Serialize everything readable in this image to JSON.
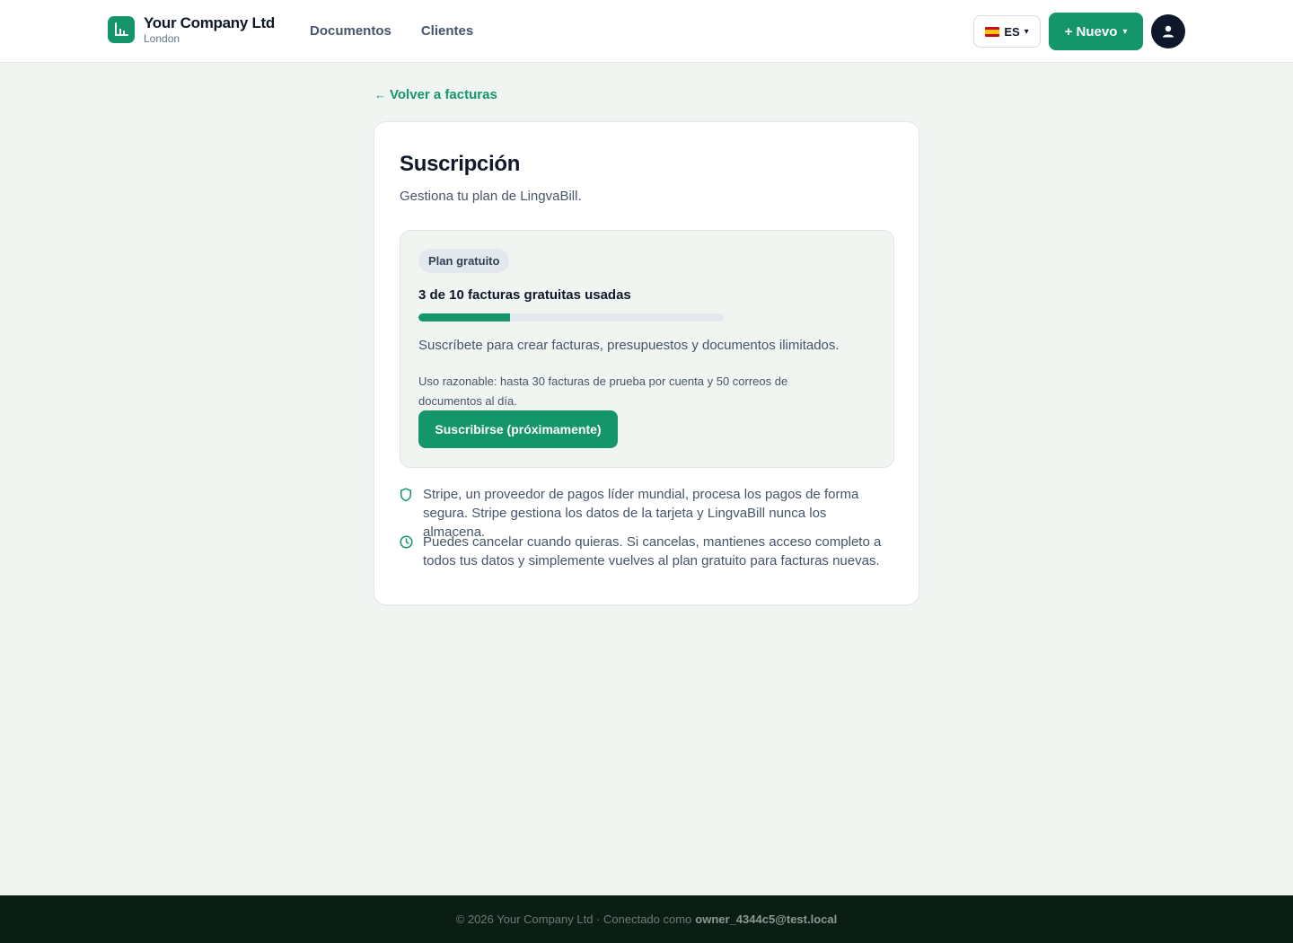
{
  "header": {
    "company_name": "Your Company Ltd",
    "company_city": "London",
    "nav": [
      "Documentos",
      "Clientes"
    ],
    "language": "ES",
    "new_button": "+ Nuevo",
    "brand_color": "#15966a"
  },
  "back_link": "Volver a facturas",
  "card": {
    "title": "Suscripción",
    "subtitle": "Gestiona tu plan de LingvaBill.",
    "plan": {
      "badge": "Plan gratuito",
      "usage_title": "3 de 10 facturas gratuitas usadas",
      "usage_fraction": 0.3,
      "description": "Suscríbete para crear facturas, presupuestos y documentos ilimitados.",
      "fair_use": "Uso razonable: hasta 30 facturas de prueba por cuenta y 50 correos de documentos al día.",
      "subscribe_button": "Suscribirse (próximamente)"
    },
    "info": [
      {
        "icon": "shield-icon",
        "text": "Stripe, un proveedor de pagos líder mundial, procesa los pagos de forma segura. Stripe gestiona los datos de la tarjeta y LingvaBill nunca los almacena."
      },
      {
        "icon": "clock-icon",
        "text": "Puedes cancelar cuando quieras. Si cancelas, mantienes acceso completo a todos tus datos y simplemente vuelves al plan gratuito para facturas nuevas."
      }
    ]
  },
  "footer": {
    "text": "© 2026 Your Company Ltd · Conectado como",
    "email": "owner_4344c5@test.local"
  }
}
